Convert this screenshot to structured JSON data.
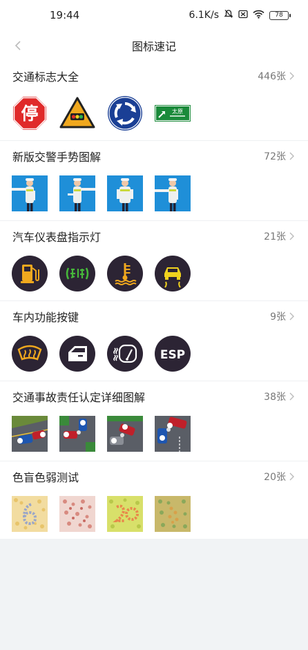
{
  "status_bar": {
    "time": "19:44",
    "network_speed": "6.1K/s",
    "battery": "78"
  },
  "nav": {
    "title": "图标速记"
  },
  "sections": [
    {
      "title": "交通标志大全",
      "count": "446张"
    },
    {
      "title": "新版交警手势图解",
      "count": "72张"
    },
    {
      "title": "汽车仪表盘指示灯",
      "count": "21张"
    },
    {
      "title": "车内功能按键",
      "count": "9张"
    },
    {
      "title": "交通事故责任认定详细图解",
      "count": "38张"
    },
    {
      "title": "色盲色弱测试",
      "count": "20张"
    }
  ],
  "traffic_signs": {
    "stop_text": "停",
    "guide_text": "太原"
  },
  "car_buttons": {
    "esp_text": "ESP"
  },
  "colors": {
    "accent_dark_circle": "#2c2434",
    "warning_orange": "#f0a81e",
    "stop_red": "#e02a2a",
    "sign_blue": "#1a3f95",
    "guide_green": "#1a8a3a"
  }
}
